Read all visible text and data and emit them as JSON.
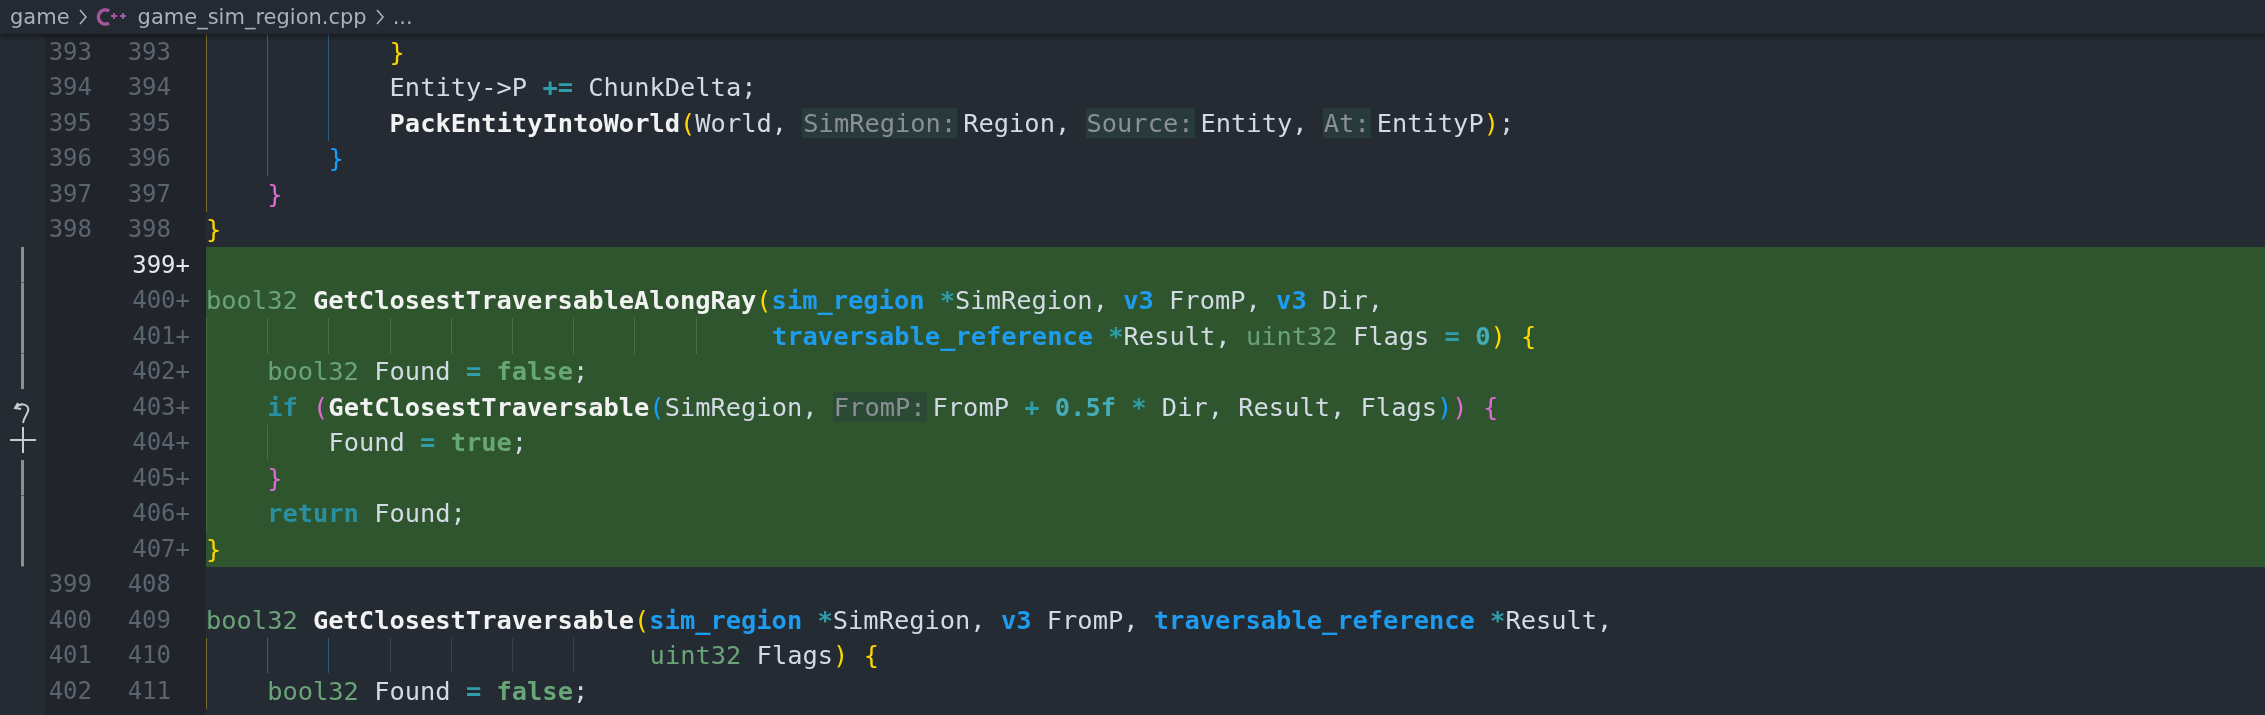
{
  "breadcrumb": {
    "items": [
      {
        "kind": "folder",
        "text": "game"
      },
      {
        "kind": "cpp-file",
        "text": "game_sim_region.cpp"
      },
      {
        "kind": "more",
        "text": "..."
      }
    ]
  },
  "lines": [
    {
      "old": "393",
      "new": "393",
      "added": false,
      "current": false,
      "tokens": [
        {
          "kind": "brace1",
          "text": "            }"
        }
      ]
    },
    {
      "old": "394",
      "new": "394",
      "added": false,
      "current": false,
      "tokens": [
        {
          "kind": "plain",
          "text": "            Entity->P "
        },
        {
          "kind": "op",
          "text": "+="
        },
        {
          "kind": "plain",
          "text": " ChunkDelta;"
        }
      ]
    },
    {
      "old": "395",
      "new": "395",
      "added": false,
      "current": false,
      "tokens": [
        {
          "kind": "func",
          "text": "            PackEntityIntoWorld"
        },
        {
          "kind": "brace1",
          "text": "("
        },
        {
          "kind": "plain",
          "text": "World, "
        },
        {
          "kind": "hint",
          "text": "SimRegion:"
        },
        {
          "kind": "plain",
          "text": "Region, "
        },
        {
          "kind": "hint",
          "text": "Source:"
        },
        {
          "kind": "plain",
          "text": "Entity, "
        },
        {
          "kind": "hint",
          "text": "At:"
        },
        {
          "kind": "plain",
          "text": "EntityP"
        },
        {
          "kind": "brace1",
          "text": ")"
        },
        {
          "kind": "plain",
          "text": ";"
        }
      ]
    },
    {
      "old": "396",
      "new": "396",
      "added": false,
      "current": false,
      "tokens": [
        {
          "kind": "brace3",
          "text": "        }"
        }
      ]
    },
    {
      "old": "397",
      "new": "397",
      "added": false,
      "current": false,
      "tokens": [
        {
          "kind": "brace2",
          "text": "    }"
        }
      ]
    },
    {
      "old": "398",
      "new": "398",
      "added": false,
      "current": false,
      "tokens": [
        {
          "kind": "brace1",
          "text": "}"
        }
      ]
    },
    {
      "new": "399+",
      "added": true,
      "current": true
    },
    {
      "new": "400+",
      "added": true,
      "current": false,
      "tokens": [
        {
          "kind": "type",
          "text": "bool32"
        },
        {
          "kind": "func",
          "text": " GetClosestTraversableAlongRay"
        },
        {
          "kind": "brace1",
          "text": "("
        },
        {
          "kind": "struct",
          "text": "sim_region"
        },
        {
          "kind": "op",
          "text": " *"
        },
        {
          "kind": "plain",
          "text": "SimRegion, "
        },
        {
          "kind": "struct",
          "text": "v3"
        },
        {
          "kind": "plain",
          "text": " FromP, "
        },
        {
          "kind": "struct",
          "text": "v3"
        },
        {
          "kind": "plain",
          "text": " Dir,"
        }
      ]
    },
    {
      "new": "401+",
      "added": true,
      "current": false,
      "tokens": [
        {
          "kind": "struct",
          "text": "                                     traversable_reference"
        },
        {
          "kind": "op",
          "text": " *"
        },
        {
          "kind": "plain",
          "text": "Result, "
        },
        {
          "kind": "type",
          "text": "uint32"
        },
        {
          "kind": "plain",
          "text": " Flags "
        },
        {
          "kind": "op",
          "text": "="
        },
        {
          "kind": "num",
          "text": " 0"
        },
        {
          "kind": "brace1",
          "text": ")"
        },
        {
          "kind": "brace1",
          "text": " {"
        }
      ]
    },
    {
      "new": "402+",
      "added": true,
      "current": false,
      "tokens": [
        {
          "kind": "type",
          "text": "    bool32"
        },
        {
          "kind": "plain",
          "text": " Found "
        },
        {
          "kind": "op",
          "text": "="
        },
        {
          "kind": "const",
          "text": " false"
        },
        {
          "kind": "plain",
          "text": ";"
        }
      ]
    },
    {
      "new": "403+",
      "added": true,
      "current": false,
      "tokens": [
        {
          "kind": "kw",
          "text": "    if"
        },
        {
          "kind": "brace2",
          "text": " ("
        },
        {
          "kind": "func",
          "text": "GetClosestTraversable"
        },
        {
          "kind": "brace3",
          "text": "("
        },
        {
          "kind": "plain",
          "text": "SimRegion, "
        },
        {
          "kind": "hint",
          "text": "FromP:"
        },
        {
          "kind": "plain",
          "text": "FromP "
        },
        {
          "kind": "op",
          "text": "+"
        },
        {
          "kind": "num",
          "text": " 0.5f"
        },
        {
          "kind": "op",
          "text": " *"
        },
        {
          "kind": "plain",
          "text": " Dir, Result, Flags"
        },
        {
          "kind": "brace3",
          "text": ")"
        },
        {
          "kind": "brace2",
          "text": ")"
        },
        {
          "kind": "brace2",
          "text": " {"
        }
      ]
    },
    {
      "new": "404+",
      "added": true,
      "current": false,
      "tokens": [
        {
          "kind": "plain",
          "text": "        Found "
        },
        {
          "kind": "op",
          "text": "="
        },
        {
          "kind": "const",
          "text": " true"
        },
        {
          "kind": "plain",
          "text": ";"
        }
      ]
    },
    {
      "new": "405+",
      "added": true,
      "current": false,
      "tokens": [
        {
          "kind": "brace2",
          "text": "    }"
        }
      ]
    },
    {
      "new": "406+",
      "added": true,
      "current": false,
      "tokens": [
        {
          "kind": "kw",
          "text": "    return"
        },
        {
          "kind": "plain",
          "text": " Found;"
        }
      ]
    },
    {
      "new": "407+",
      "added": true,
      "current": false,
      "tokens": [
        {
          "kind": "brace1",
          "text": "}"
        }
      ]
    },
    {
      "old": "399",
      "new": "408",
      "added": false,
      "current": false
    },
    {
      "old": "400",
      "new": "409",
      "added": false,
      "current": false,
      "tokens": [
        {
          "kind": "type",
          "text": "bool32"
        },
        {
          "kind": "func",
          "text": " GetClosestTraversable"
        },
        {
          "kind": "brace1",
          "text": "("
        },
        {
          "kind": "struct",
          "text": "sim_region"
        },
        {
          "kind": "op",
          "text": " *"
        },
        {
          "kind": "plain",
          "text": "SimRegion, "
        },
        {
          "kind": "struct",
          "text": "v3"
        },
        {
          "kind": "plain",
          "text": " FromP, "
        },
        {
          "kind": "struct",
          "text": "traversable_reference"
        },
        {
          "kind": "op",
          "text": " *"
        },
        {
          "kind": "plain",
          "text": "Result,"
        }
      ]
    },
    {
      "old": "401",
      "new": "410",
      "added": false,
      "current": false,
      "tokens": [
        {
          "kind": "type",
          "text": "                             uint32"
        },
        {
          "kind": "plain",
          "text": " Flags"
        },
        {
          "kind": "brace1",
          "text": ")"
        },
        {
          "kind": "brace1",
          "text": " {"
        }
      ]
    },
    {
      "old": "402",
      "new": "411",
      "added": false,
      "current": false,
      "tokens": [
        {
          "kind": "type",
          "text": "    bool32"
        },
        {
          "kind": "plain",
          "text": " Found "
        },
        {
          "kind": "op",
          "text": "="
        },
        {
          "kind": "const",
          "text": " false"
        },
        {
          "kind": "plain",
          "text": ";"
        }
      ]
    }
  ]
}
